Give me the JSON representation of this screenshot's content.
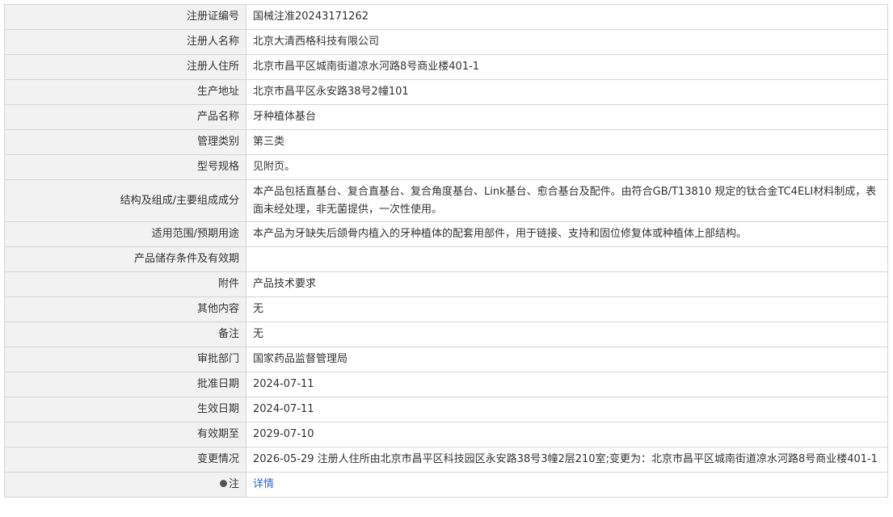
{
  "rows": [
    {
      "label": "注册证编号",
      "value": "国械注准20243171262"
    },
    {
      "label": "注册人名称",
      "value": "北京大清西格科技有限公司"
    },
    {
      "label": "注册人住所",
      "value": "北京市昌平区城南街道凉水河路8号商业楼401-1"
    },
    {
      "label": "生产地址",
      "value": "北京市昌平区永安路38号2幢101"
    },
    {
      "label": "产品名称",
      "value": "牙种植体基台"
    },
    {
      "label": "管理类别",
      "value": "第三类"
    },
    {
      "label": "型号规格",
      "value": "见附页。"
    },
    {
      "label": "结构及组成/主要组成成分",
      "value": "本产品包括直基台、复合直基台、复合角度基台、Link基台、愈合基台及配件。由符合GB/T13810 规定的钛合金TC4ELI材料制成，表面未经处理，非无菌提供，一次性使用。"
    },
    {
      "label": "适用范围/预期用途",
      "value": "本产品为牙缺失后颌骨内植入的牙种植体的配套用部件，用于链接、支持和固位修复体或种植体上部结构。"
    },
    {
      "label": "产品储存条件及有效期",
      "value": ""
    },
    {
      "label": "附件",
      "value": "产品技术要求"
    },
    {
      "label": "其他内容",
      "value": "无"
    },
    {
      "label": "备注",
      "value": "无"
    },
    {
      "label": "审批部门",
      "value": "国家药品监督管理局"
    },
    {
      "label": "批准日期",
      "value": "2024-07-11"
    },
    {
      "label": "生效日期",
      "value": "2024-07-11"
    },
    {
      "label": "有效期至",
      "value": "2029-07-10"
    },
    {
      "label": "变更情况",
      "value": "2026-05-29 注册人住所由北京市昌平区科技园区永安路38号3幢2层210室;变更为：北京市昌平区城南街道凉水河路8号商业楼401-1"
    }
  ],
  "note": {
    "label": "注",
    "icon": "lightbulb-icon",
    "link_text": "详情",
    "link_color": "#3366cc"
  },
  "colors": {
    "label_bg": "#f2f2f2",
    "border": "#d6d6d6",
    "text": "#333333"
  }
}
